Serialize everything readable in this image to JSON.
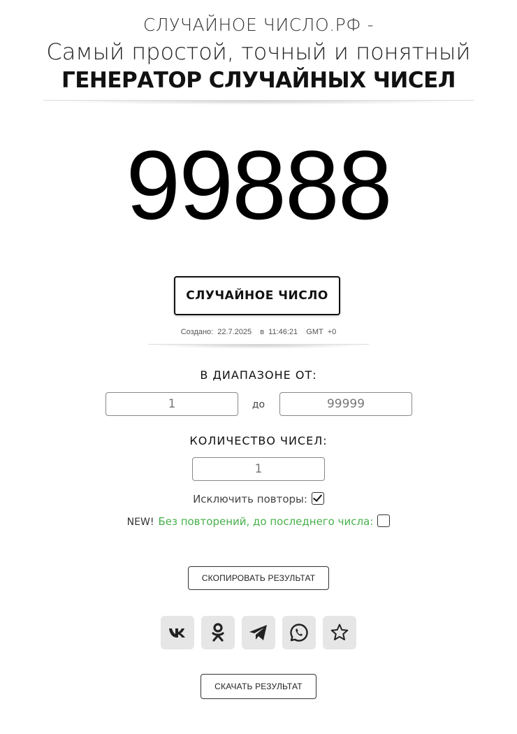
{
  "header": {
    "site_name": "СЛУЧАЙНОЕ ЧИСЛО.РФ -",
    "tagline": "Самый простой, точный и понятный",
    "headline": "ГЕНЕРАТОР СЛУЧАЙНЫХ ЧИСЕЛ"
  },
  "result": {
    "number": "99888"
  },
  "generate_button": {
    "label": "СЛУЧАЙНОЕ ЧИСЛО"
  },
  "created": {
    "prefix": "Создано:",
    "date": "22.7.2025",
    "at": "в",
    "time": "11:46:21",
    "tz_label": "GMT",
    "tz_value": "+0"
  },
  "range": {
    "label": "В ДИАПАЗОНЕ ОТ:",
    "from_value": "1",
    "to_label": "до",
    "to_value": "99999"
  },
  "count": {
    "label": "КОЛИЧЕСТВО ЧИСЕЛ:",
    "value": "1"
  },
  "exclude_repeats": {
    "label": "Исключить повторы:",
    "checked": true
  },
  "no_repeats_until_last": {
    "badge": "NEW!",
    "label": "Без повторений, до последнего числа:",
    "checked": false
  },
  "copy_button": {
    "label": "СКОПИРОВАТЬ РЕЗУЛЬТАТ"
  },
  "share": {
    "icons": [
      "vk-icon",
      "odnoklassniki-icon",
      "telegram-icon",
      "whatsapp-icon",
      "star-icon"
    ]
  },
  "download_button": {
    "label": "СКАЧАТЬ РЕЗУЛЬТАТ"
  },
  "colors": {
    "accent_green": "#47b04b",
    "share_bg": "#e6e6e6"
  }
}
